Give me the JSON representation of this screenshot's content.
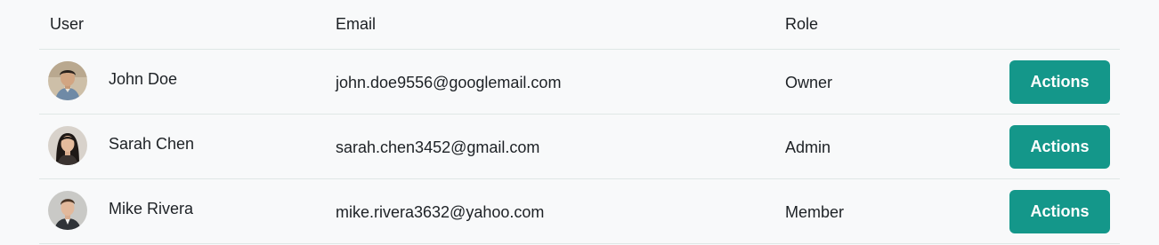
{
  "table": {
    "headers": {
      "user": "User",
      "email": "Email",
      "role": "Role"
    },
    "rows": [
      {
        "name": "John Doe",
        "email": "john.doe9556@googlemail.com",
        "role": "Owner",
        "action_label": "Actions"
      },
      {
        "name": "Sarah Chen",
        "email": "sarah.chen3452@gmail.com",
        "role": "Admin",
        "action_label": "Actions"
      },
      {
        "name": "Mike Rivera",
        "email": "mike.rivera3632@yahoo.com",
        "role": "Member",
        "action_label": "Actions"
      }
    ]
  },
  "colors": {
    "accent": "#14978a",
    "divider": "#dfe7e6",
    "background": "#f8f9fa"
  }
}
